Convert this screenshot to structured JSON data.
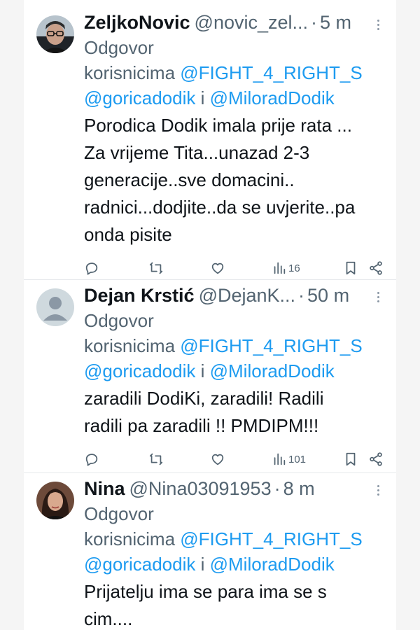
{
  "tweets": [
    {
      "name": "ZeljkoNovic",
      "handle": "@novic_zel...",
      "time": "5 m",
      "reply_prefix": "Odgovor",
      "reply_to_label": "korisnicima",
      "mention1": "@FIGHT_4_RIGHT_S",
      "mention2": "@goricadodik",
      "conj": "i",
      "mention3": "@MiloradDodik",
      "lines": [
        "Porodica Dodik imala prije rata ...",
        "Za vrijeme Tita...unazad 2-3",
        "generacije..sve domacini..",
        "radnici...dodjite..da se uvjerite..pa",
        "onda pisite"
      ],
      "views": "16",
      "avatar_icon": "user-photo-glasses"
    },
    {
      "name": "Dejan Krstić",
      "handle": "@DejanK...",
      "time": "50 m",
      "reply_prefix": "Odgovor",
      "reply_to_label": "korisnicima",
      "mention1": "@FIGHT_4_RIGHT_S",
      "mention2": "@goricadodik",
      "conj": "i",
      "mention3": "@MiloradDodik",
      "lines": [
        "zaradili DodiKi, zaradili! Radili",
        "radili pa zaradili !! PMDIPM!!!"
      ],
      "views": "101",
      "avatar_icon": "default-user-silhouette"
    },
    {
      "name": "Nina",
      "handle": "@Nina03091953",
      "time": "8 m",
      "reply_prefix": "Odgovor",
      "reply_to_label": "korisnicima",
      "mention1": "@FIGHT_4_RIGHT_S",
      "mention2": "@goricadodik",
      "conj": "i",
      "mention3": "@MiloradDodik",
      "lines": [
        "Prijatelju ima se para ima se s",
        "cim...."
      ],
      "avatar_icon": "user-photo-woman"
    }
  ],
  "colors": {
    "link": "#1d9bf0",
    "muted": "#536471",
    "text": "#0f1419"
  },
  "separator": "·"
}
